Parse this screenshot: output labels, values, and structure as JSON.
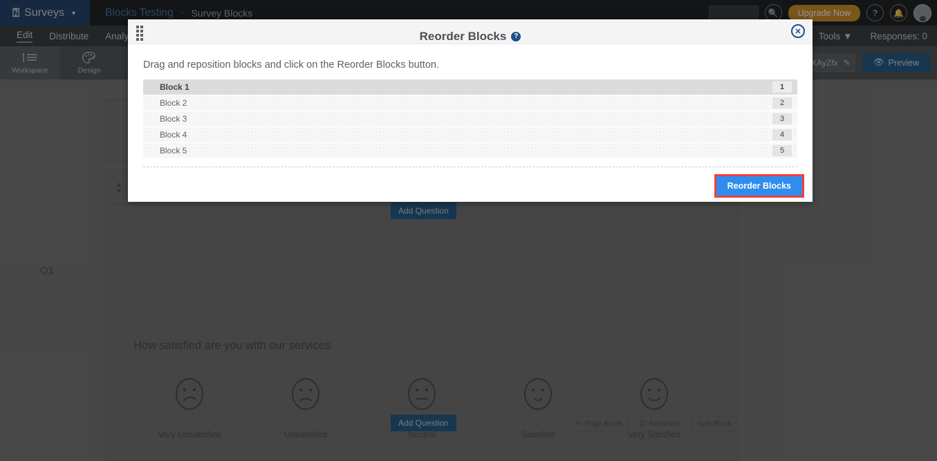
{
  "topbar": {
    "brand": "Surveys",
    "brand_icon": "qualtrics-q-icon",
    "brand_caret": "caret-down-icon",
    "breadcrumb_parent": "Blocks Testing",
    "breadcrumb_sep": "›",
    "breadcrumb_current": "Survey Blocks",
    "search_placeholder": "",
    "search_icon": "search-icon",
    "upgrade_label": "Upgrade Now",
    "help_icon": "question-mark-icon",
    "bell_icon": "bell-icon",
    "avatar_icon": "user-avatar-icon"
  },
  "menubar": {
    "items": [
      {
        "label": "Edit",
        "active": true
      },
      {
        "label": "Distribute",
        "active": false
      },
      {
        "label": "Analytics",
        "active": false
      }
    ],
    "tools_label": "Tools",
    "tools_caret": "caret-down-icon",
    "responses_label": "Responses: 0"
  },
  "toolbar": {
    "items": [
      {
        "label": "Workspace",
        "icon": "workspace-icon",
        "selected": true
      },
      {
        "label": "Design",
        "icon": "palette-icon",
        "selected": false
      }
    ],
    "survey_url": "t/AOXAyZfx",
    "edit_icon": "pencil-icon",
    "preview_label": "Preview",
    "preview_icon": "eye-icon"
  },
  "canvas": {
    "question_number": "Q1",
    "collapse_icon": "collapse-chevrons-icon",
    "question_title": "How satisfied are you with our services",
    "scale": [
      {
        "label": "Very Unsatisfied",
        "icon": "face-very-sad-icon"
      },
      {
        "label": "Unsatisfied",
        "icon": "face-sad-icon"
      },
      {
        "label": "Neutral",
        "icon": "face-neutral-icon"
      },
      {
        "label": "Satisfied",
        "icon": "face-happy-icon"
      },
      {
        "label": "Very Satisfied",
        "icon": "face-very-happy-icon"
      }
    ],
    "add_question_top": "Add Question",
    "add_question_bottom": "Add Question",
    "mini_buttons": [
      {
        "label": "Page Break",
        "icon": "page-break-icon"
      },
      {
        "label": "Separator",
        "icon": "separator-icon"
      },
      {
        "label": "Split Block",
        "icon": ""
      }
    ]
  },
  "modal": {
    "title": "Reorder Blocks",
    "title_help_icon": "help-circle-icon",
    "drag_handle_icon": "drag-handle-icon",
    "close_icon": "close-icon",
    "description": "Drag and reposition blocks and click on the Reorder Blocks button.",
    "blocks": [
      {
        "label": "Block 1",
        "position": "1"
      },
      {
        "label": "Block 2",
        "position": "2"
      },
      {
        "label": "Block 3",
        "position": "3"
      },
      {
        "label": "Block 4",
        "position": "4"
      },
      {
        "label": "Block 5",
        "position": "5"
      }
    ],
    "submit_label": "Reorder Blocks"
  },
  "colors": {
    "brand_navy": "#143862",
    "topbar_dark": "#101316",
    "accent_blue": "#2e8ded",
    "highlight_red": "#fb3b3b",
    "upgrade_gold": "#c78a18",
    "preview_blue": "#17507f",
    "modal_accent": "#1f4e89"
  }
}
